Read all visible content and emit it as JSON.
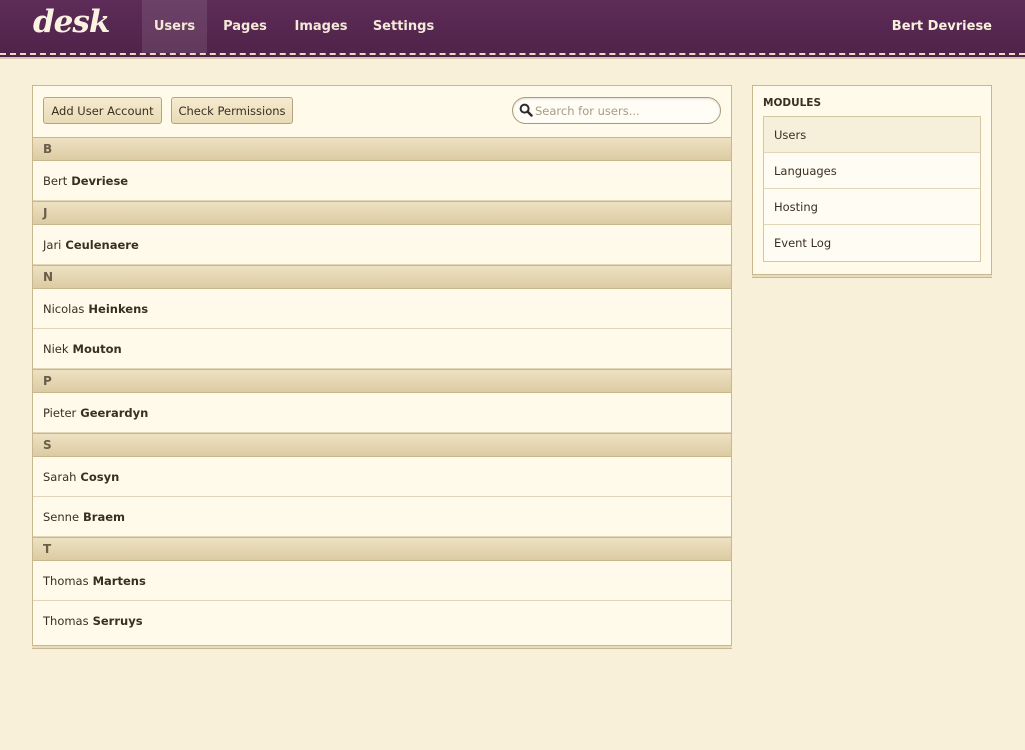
{
  "app": {
    "logo": "desk",
    "current_user": "Bert Devriese"
  },
  "nav": {
    "items": [
      {
        "label": "Users",
        "active": true
      },
      {
        "label": "Pages",
        "active": false
      },
      {
        "label": "Images",
        "active": false
      },
      {
        "label": "Settings",
        "active": false
      }
    ]
  },
  "toolbar": {
    "add_label": "Add User Account",
    "check_label": "Check Permissions",
    "search_placeholder": "Search for users..."
  },
  "groups": [
    {
      "letter": "B",
      "users": [
        {
          "first": "Bert",
          "last": "Devriese"
        }
      ]
    },
    {
      "letter": "J",
      "users": [
        {
          "first": "Jari",
          "last": "Ceulenaere"
        }
      ]
    },
    {
      "letter": "N",
      "users": [
        {
          "first": "Nicolas",
          "last": "Heinkens"
        },
        {
          "first": "Niek",
          "last": "Mouton"
        }
      ]
    },
    {
      "letter": "P",
      "users": [
        {
          "first": "Pieter",
          "last": "Geerardyn"
        }
      ]
    },
    {
      "letter": "S",
      "users": [
        {
          "first": "Sarah",
          "last": "Cosyn"
        },
        {
          "first": "Senne",
          "last": "Braem"
        }
      ]
    },
    {
      "letter": "T",
      "users": [
        {
          "first": "Thomas",
          "last": "Martens"
        },
        {
          "first": "Thomas",
          "last": "Serruys"
        }
      ]
    }
  ],
  "modules": {
    "title": "MODULES",
    "items": [
      {
        "label": "Users",
        "active": true
      },
      {
        "label": "Languages",
        "active": false
      },
      {
        "label": "Hosting",
        "active": false
      },
      {
        "label": "Event Log",
        "active": false
      }
    ]
  },
  "colors": {
    "header_bg": "#5a2a55",
    "page_bg": "#f8f0d9",
    "panel_bg": "#fffaea",
    "group_header_bg": "#e6d8b3"
  },
  "icons": {
    "search": "search-icon"
  }
}
